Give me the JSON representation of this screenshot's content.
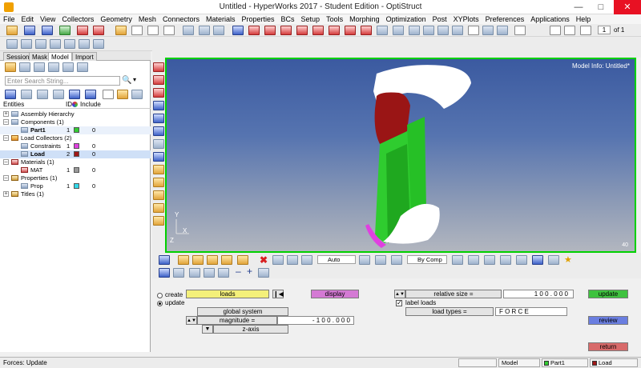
{
  "window": {
    "title": "Untitled - HyperWorks 2017 - Student Edition - OptiStruct"
  },
  "menu": [
    "File",
    "Edit",
    "View",
    "Collectors",
    "Geometry",
    "Mesh",
    "Connectors",
    "Materials",
    "Properties",
    "BCs",
    "Setup",
    "Tools",
    "Morphing",
    "Optimization",
    "Post",
    "XYPlots",
    "Preferences",
    "Applications",
    "Help"
  ],
  "page_nav": {
    "value": "1",
    "total": "of 1"
  },
  "browser": {
    "tabs": [
      "Session",
      "Mask",
      "Model",
      "Import"
    ],
    "active_tab": "Model",
    "search_placeholder": "Enter Search String...",
    "columns": {
      "entities": "Entities",
      "id": "ID",
      "include": "Include"
    },
    "rows": [
      {
        "label": "Assembly Hierarchy",
        "id": "",
        "include": "",
        "color": ""
      },
      {
        "label": "Components (1)",
        "id": "",
        "include": "",
        "color": ""
      },
      {
        "label": "Part1",
        "id": "1",
        "include": "0",
        "color": "#33cc33"
      },
      {
        "label": "Load Collectors (2)",
        "id": "",
        "include": "",
        "color": ""
      },
      {
        "label": "Constraints",
        "id": "1",
        "include": "0",
        "color": "#e040e0"
      },
      {
        "label": "Load",
        "id": "2",
        "include": "0",
        "color": "#a01818"
      },
      {
        "label": "Materials (1)",
        "id": "",
        "include": "",
        "color": ""
      },
      {
        "label": "MAT",
        "id": "1",
        "include": "0",
        "color": "#9a9a9a"
      },
      {
        "label": "Properties (1)",
        "id": "",
        "include": "",
        "color": ""
      },
      {
        "label": "Prop",
        "id": "1",
        "include": "0",
        "color": "#33d8e8"
      },
      {
        "label": "Titles (1)",
        "id": "",
        "include": "",
        "color": ""
      }
    ]
  },
  "viewport": {
    "model_info": "Model Info: Untitled*",
    "triad_y": "Y",
    "triad_x": "X",
    "triad_z": "Z",
    "scale": "40"
  },
  "graphics_toolbar": {
    "vis_mode": "Auto",
    "color_mode": "By Comp"
  },
  "panel": {
    "create_label": "create",
    "update_label": "update",
    "loads_label": "loads",
    "display_label": "display",
    "global_system_label": "global system",
    "magnitude_label": "magnitude =",
    "magnitude_value": "- 1 0 0 . 0 0 0",
    "z_axis_label": "z-axis",
    "relative_size_label": "relative size =",
    "relative_size_value": "1 0 0 . 0 0 0",
    "label_loads_label": "label loads",
    "load_types_label": "load types =",
    "load_types_value": "F O R C E",
    "update_button": "update",
    "review_button": "review",
    "return_button": "return"
  },
  "status": {
    "message": "Forces: Update",
    "model_label": "Model",
    "component": "Part1",
    "load_collector": "Load"
  },
  "colors": {
    "viewport_border": "#00d000",
    "part_green": "#22cc22",
    "load_red": "#a01818",
    "loads_button": "#f4f07a",
    "display_button": "#d47ad4",
    "update_button": "#3fc23f",
    "review_button": "#6a7ee0",
    "return_button": "#d86a6a"
  }
}
